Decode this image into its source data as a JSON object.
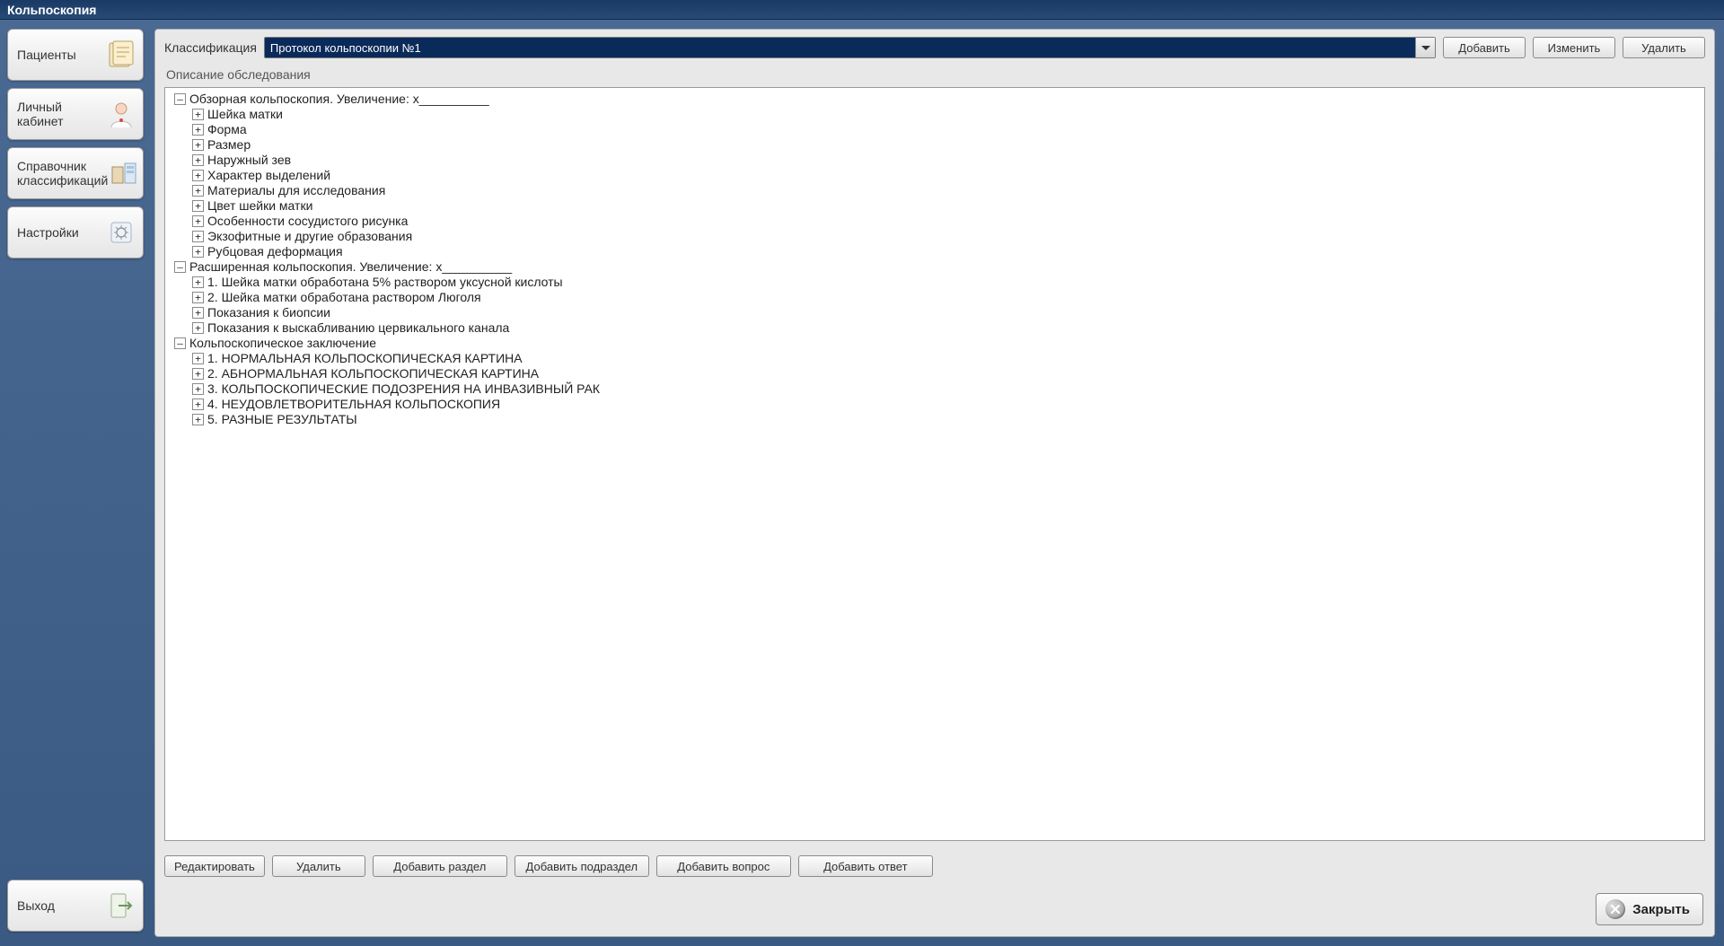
{
  "app": {
    "title": "Кольпоскопия"
  },
  "sidebar": {
    "items": [
      {
        "label": "Пациенты"
      },
      {
        "label": "Личный кабинет"
      },
      {
        "label": "Справочник классификаций"
      },
      {
        "label": "Настройки"
      }
    ],
    "exit": {
      "label": "Выход"
    }
  },
  "toolbar1": {
    "classification_label": "Классификация",
    "combo_value": "Протокол кольпоскопии №1",
    "add": "Добавить",
    "edit": "Изменить",
    "delete": "Удалить"
  },
  "subheader": "Описание обследования",
  "tree": [
    {
      "label": "Обзорная кольпоскопия. Увеличение: х__________",
      "expanded": true,
      "children": [
        {
          "label": "Шейка матки",
          "expandable": true
        },
        {
          "label": "Форма",
          "expandable": true
        },
        {
          "label": "Размер",
          "expandable": true
        },
        {
          "label": "Наружный зев",
          "expandable": true
        },
        {
          "label": "Характер выделений",
          "expandable": true
        },
        {
          "label": "Материалы для исследования",
          "expandable": true
        },
        {
          "label": "Цвет шейки матки",
          "expandable": true
        },
        {
          "label": "Особенности сосудистого рисунка",
          "expandable": true
        },
        {
          "label": "Экзофитные и другие образования",
          "expandable": true
        },
        {
          "label": "Рубцовая деформация",
          "expandable": true
        }
      ]
    },
    {
      "label": "Расширенная кольпоскопия. Увеличение: х__________",
      "expanded": true,
      "children": [
        {
          "label": "1. Шейка матки обработана 5% раствором уксусной кислоты",
          "expandable": true
        },
        {
          "label": "2. Шейка матки обработана раствором Люголя",
          "expandable": true
        },
        {
          "label": "Показания к биопсии",
          "expandable": true
        },
        {
          "label": "Показания к выскабливанию цервикального канала",
          "expandable": true
        }
      ]
    },
    {
      "label": "Кольпоскопическое заключение",
      "expanded": true,
      "children": [
        {
          "label": "1. НОРМАЛЬНАЯ КОЛЬПОСКОПИЧЕСКАЯ КАРТИНА",
          "expandable": true
        },
        {
          "label": "2. АБНОРМАЛЬНАЯ КОЛЬПОСКОПИЧЕСКАЯ КАРТИНА",
          "expandable": true
        },
        {
          "label": "3. КОЛЬПОСКОПИЧЕСКИЕ ПОДОЗРЕНИЯ НА ИНВАЗИВНЫЙ РАК",
          "expandable": true
        },
        {
          "label": "4. НЕУДОВЛЕТВОРИТЕЛЬНАЯ КОЛЬПОСКОПИЯ",
          "expandable": true
        },
        {
          "label": "5. РАЗНЫЕ РЕЗУЛЬТАТЫ",
          "expandable": true
        }
      ]
    }
  ],
  "toolbar2": {
    "edit": "Редактировать",
    "delete": "Удалить",
    "add_section": "Добавить раздел",
    "add_subsection": "Добавить подраздел",
    "add_question": "Добавить вопрос",
    "add_answer": "Добавить ответ"
  },
  "footer": {
    "close": "Закрыть"
  }
}
